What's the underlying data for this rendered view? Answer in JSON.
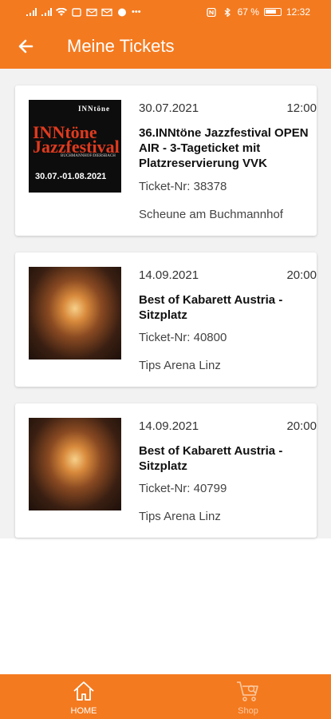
{
  "status_bar": {
    "battery": "67 %",
    "time": "12:32"
  },
  "header": {
    "title": "Meine Tickets",
    "back_icon": "arrow-left-icon"
  },
  "tickets": [
    {
      "date": "30.07.2021",
      "time": "12:00",
      "title": "36.INNtöne Jazzfestival OPEN AIR - 3-Tageticket mit Platzreservierung VVK",
      "ticket_nr": "Ticket-Nr: 38378",
      "venue": "Scheune am Buchmannhof",
      "poster": {
        "logo": "INNtöne",
        "name_line1": "INNtöne",
        "name_line2": "Jazzfestival",
        "subtitle": "BUCHMANNHOF/DIERSBACH",
        "dates": "30.07.-01.08.2021"
      }
    },
    {
      "date": "14.09.2021",
      "time": "20:00",
      "title": "Best of Kabarett Austria - Sitzplatz",
      "ticket_nr": "Ticket-Nr: 40800",
      "venue": "Tips Arena Linz"
    },
    {
      "date": "14.09.2021",
      "time": "20:00",
      "title": "Best of Kabarett Austria - Sitzplatz",
      "ticket_nr": "Ticket-Nr: 40799",
      "venue": "Tips Arena Linz"
    }
  ],
  "bottom_nav": {
    "home_label": "HOME",
    "shop_label": "Shop",
    "home_icon": "home-icon",
    "shop_icon": "cart-icon"
  },
  "colors": {
    "accent": "#f47a1f",
    "background": "#f2f2f2"
  }
}
